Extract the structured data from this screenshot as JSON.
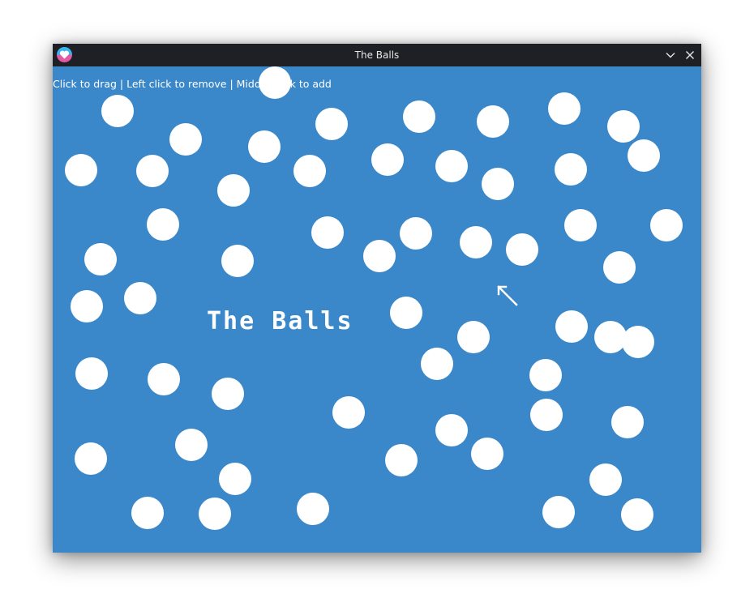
{
  "window": {
    "title": "The Balls",
    "icon": "heart-app-icon",
    "buttons": [
      "minimize-chevron-icon",
      "close-icon"
    ]
  },
  "canvas": {
    "background_color": "#3a87c9",
    "ball_color": "#ffffff",
    "hint": "Click to drag | Left click to remove | Middle click to add",
    "heading": "The Balls",
    "ball_count": 61
  },
  "cursor": "arrow-cursor-icon"
}
